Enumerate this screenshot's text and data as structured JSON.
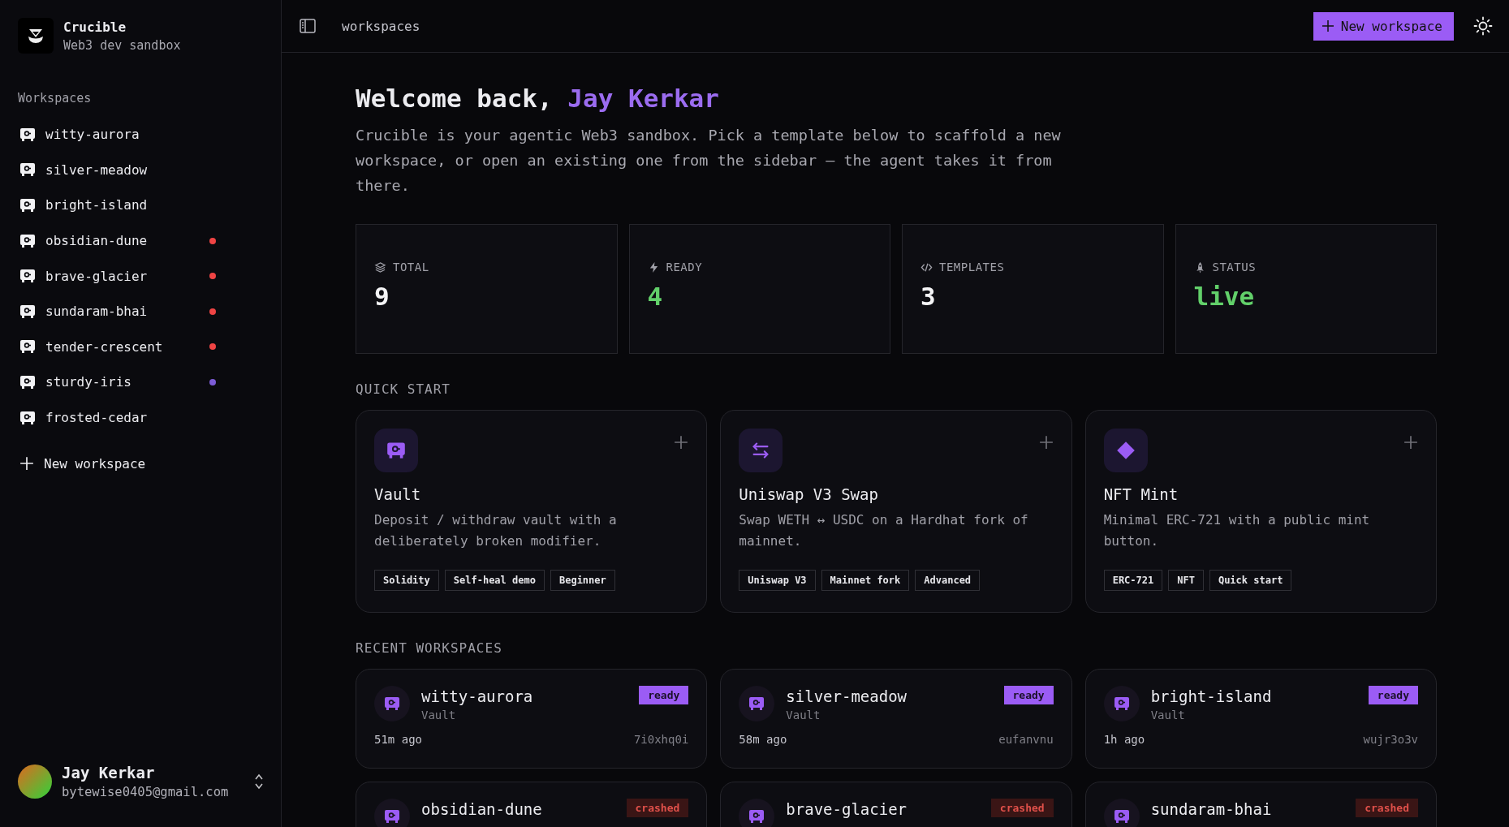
{
  "brand": {
    "name": "Crucible",
    "tagline": "Web3 dev sandbox"
  },
  "sidebar": {
    "heading": "Workspaces",
    "items": [
      {
        "label": "witty-aurora"
      },
      {
        "label": "silver-meadow"
      },
      {
        "label": "bright-island"
      },
      {
        "label": "obsidian-dune",
        "color": "#ef4444"
      },
      {
        "label": "brave-glacier",
        "color": "#ef4444"
      },
      {
        "label": "sundaram-bhai",
        "color": "#ef4444"
      },
      {
        "label": "tender-crescent",
        "color": "#ef4444"
      },
      {
        "label": "sturdy-iris",
        "color": "#7c5cd6"
      },
      {
        "label": "frosted-cedar"
      }
    ],
    "new_button": "New workspace",
    "user": {
      "name": "Jay Kerkar",
      "email": "bytewise0405@gmail.com"
    }
  },
  "header": {
    "breadcrumb": "workspaces",
    "new_button": "New workspace"
  },
  "welcome": {
    "greeting": "Welcome back,",
    "name": "Jay Kerkar",
    "intro": "Crucible is your agentic Web3 sandbox. Pick a template below to scaffold a new workspace, or open an existing one from the sidebar — the agent takes it from there."
  },
  "stats": [
    {
      "kind": "total",
      "label": "TOTAL",
      "value": "9",
      "highlight": false
    },
    {
      "kind": "ready",
      "label": "READY",
      "value": "4",
      "highlight": true
    },
    {
      "kind": "templates",
      "label": "TEMPLATES",
      "value": "3",
      "highlight": false
    },
    {
      "kind": "status",
      "label": "STATUS",
      "value": "live",
      "highlight": true
    }
  ],
  "quick_start": {
    "heading": "QUICK START",
    "templates": [
      {
        "kind": "vault",
        "title": "Vault",
        "description": "Deposit / withdraw vault with a deliberately broken modifier.",
        "tags": [
          "Solidity",
          "Self-heal demo",
          "Beginner"
        ]
      },
      {
        "kind": "swap",
        "title": "Uniswap V3 Swap",
        "description": "Swap WETH ↔ USDC on a Hardhat fork of mainnet.",
        "tags": [
          "Uniswap V3",
          "Mainnet fork",
          "Advanced"
        ]
      },
      {
        "kind": "diamond",
        "title": "NFT Mint",
        "description": "Minimal ERC-721 with a public mint button.",
        "tags": [
          "ERC-721",
          "NFT",
          "Quick start"
        ]
      }
    ]
  },
  "recent": {
    "heading": "RECENT WORKSPACES",
    "workspaces": [
      {
        "name": "witty-aurora",
        "status": "ready",
        "template": "Vault",
        "time": "51m ago",
        "id": "7i0xhq0i"
      },
      {
        "name": "silver-meadow",
        "status": "ready",
        "template": "Vault",
        "time": "58m ago",
        "id": "eufanvnu"
      },
      {
        "name": "bright-island",
        "status": "ready",
        "template": "Vault",
        "time": "1h ago",
        "id": "wujr3o3v"
      },
      {
        "name": "obsidian-dune",
        "status": "crashed"
      },
      {
        "name": "brave-glacier",
        "status": "crashed"
      },
      {
        "name": "sundaram-bhai",
        "status": "crashed"
      }
    ]
  }
}
